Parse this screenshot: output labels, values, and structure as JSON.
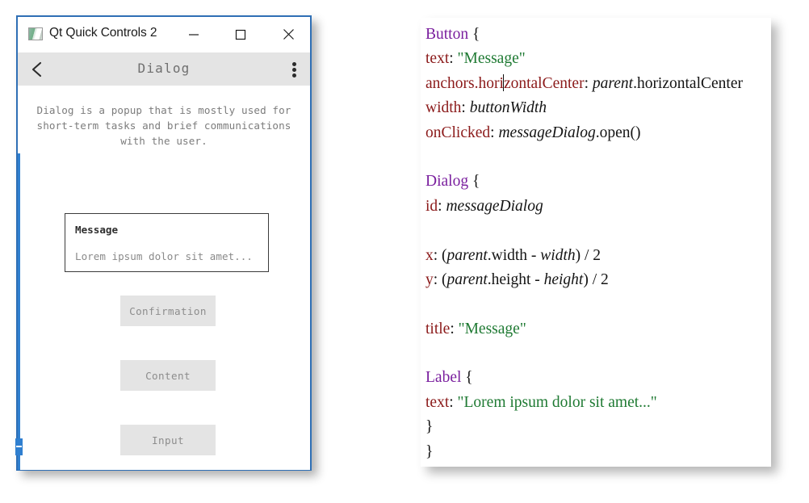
{
  "window": {
    "title": "Qt Quick Controls 2",
    "icon": "qt-logo-icon",
    "controls": {
      "minimize": "minimize-icon",
      "maximize": "maximize-icon",
      "close": "close-icon"
    },
    "border_color": "#2f6fb5"
  },
  "toolbar": {
    "back": "back-chevron-icon",
    "title": "Dialog",
    "menu": "overflow-menu-icon",
    "background": "#e4e4e4"
  },
  "page": {
    "description": "Dialog is a popup that is mostly used for short-term tasks and brief communications with the user.",
    "inline_dialog": {
      "title": "Message",
      "text": "Lorem ipsum dolor sit amet..."
    },
    "buttons": [
      {
        "label": "Confirmation"
      },
      {
        "label": "Content"
      },
      {
        "label": "Input"
      }
    ],
    "accent_color": "#2f7fd0"
  },
  "code": {
    "colors": {
      "type": "#7a1f9e",
      "property": "#8b1a1a",
      "string": "#1f7a33",
      "identifier": "#141414"
    },
    "lines": [
      {
        "id": "l1",
        "tokens": [
          {
            "t": "Button",
            "c": "type"
          },
          {
            "t": " {",
            "c": "brace"
          }
        ]
      },
      {
        "id": "l2",
        "tokens": [
          {
            "t": "text",
            "c": "prop"
          },
          {
            "t": ": ",
            "c": "plain"
          },
          {
            "t": "\"Message\"",
            "c": "str"
          }
        ]
      },
      {
        "id": "l3",
        "tokens": [
          {
            "t": "anchors.hori",
            "c": "prop"
          },
          {
            "t": "|CARET|",
            "c": "caret"
          },
          {
            "t": "zontalCenter",
            "c": "prop"
          },
          {
            "t": ": ",
            "c": "plain"
          },
          {
            "t": "parent",
            "c": "id"
          },
          {
            "t": ".horizontalCenter",
            "c": "plain"
          }
        ]
      },
      {
        "id": "l4",
        "tokens": [
          {
            "t": "width",
            "c": "prop"
          },
          {
            "t": ": ",
            "c": "plain"
          },
          {
            "t": "buttonWidth",
            "c": "id"
          }
        ]
      },
      {
        "id": "l5",
        "tokens": [
          {
            "t": "onClicked",
            "c": "prop"
          },
          {
            "t": ": ",
            "c": "plain"
          },
          {
            "t": "messageDialog",
            "c": "id"
          },
          {
            "t": ".open()",
            "c": "plain"
          }
        ]
      },
      {
        "id": "l6",
        "tokens": []
      },
      {
        "id": "l7",
        "tokens": [
          {
            "t": "Dialog",
            "c": "type"
          },
          {
            "t": " {",
            "c": "brace"
          }
        ]
      },
      {
        "id": "l8",
        "tokens": [
          {
            "t": "id",
            "c": "prop"
          },
          {
            "t": ": ",
            "c": "plain"
          },
          {
            "t": "messageDialog",
            "c": "id"
          }
        ]
      },
      {
        "id": "l9",
        "tokens": []
      },
      {
        "id": "l10",
        "tokens": [
          {
            "t": "x",
            "c": "prop"
          },
          {
            "t": ": (",
            "c": "plain"
          },
          {
            "t": "parent",
            "c": "id"
          },
          {
            "t": ".width - ",
            "c": "plain"
          },
          {
            "t": "width",
            "c": "id"
          },
          {
            "t": ") / 2",
            "c": "plain"
          }
        ]
      },
      {
        "id": "l11",
        "tokens": [
          {
            "t": "y",
            "c": "prop"
          },
          {
            "t": ": (",
            "c": "plain"
          },
          {
            "t": "parent",
            "c": "id"
          },
          {
            "t": ".height - ",
            "c": "plain"
          },
          {
            "t": "height",
            "c": "id"
          },
          {
            "t": ") / 2",
            "c": "plain"
          }
        ]
      },
      {
        "id": "l12",
        "tokens": []
      },
      {
        "id": "l13",
        "tokens": [
          {
            "t": "title",
            "c": "prop"
          },
          {
            "t": ": ",
            "c": "plain"
          },
          {
            "t": "\"Message\"",
            "c": "str"
          }
        ]
      },
      {
        "id": "l14",
        "tokens": []
      },
      {
        "id": "l15",
        "tokens": [
          {
            "t": "Label",
            "c": "type"
          },
          {
            "t": " {",
            "c": "brace"
          }
        ]
      },
      {
        "id": "l16",
        "tokens": [
          {
            "t": "text",
            "c": "prop"
          },
          {
            "t": ": ",
            "c": "plain"
          },
          {
            "t": "\"Lorem ipsum dolor sit amet...\"",
            "c": "str"
          }
        ]
      },
      {
        "id": "l17",
        "tokens": [
          {
            "t": "}",
            "c": "brace"
          }
        ]
      },
      {
        "id": "l18",
        "tokens": [
          {
            "t": "}",
            "c": "brace"
          }
        ]
      },
      {
        "id": "l19",
        "tokens": [
          {
            "t": "}",
            "c": "brace"
          }
        ]
      }
    ]
  }
}
